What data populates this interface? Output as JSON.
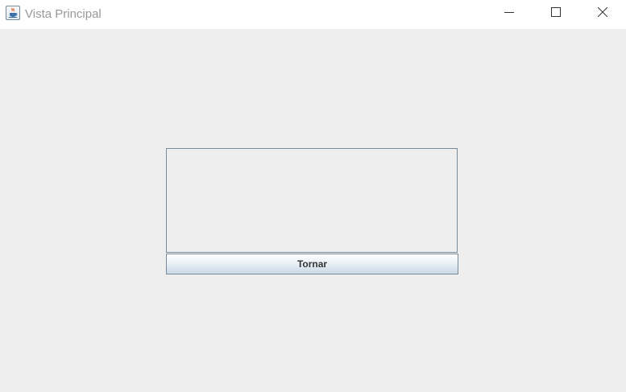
{
  "window": {
    "title": "Vista Principal",
    "icon": "java-cup-icon",
    "controls": {
      "minimize_icon": "minimize-icon",
      "maximize_icon": "maximize-icon",
      "close_icon": "close-icon"
    }
  },
  "main": {
    "text_area_value": "",
    "tornar_button_label": "Tornar"
  }
}
